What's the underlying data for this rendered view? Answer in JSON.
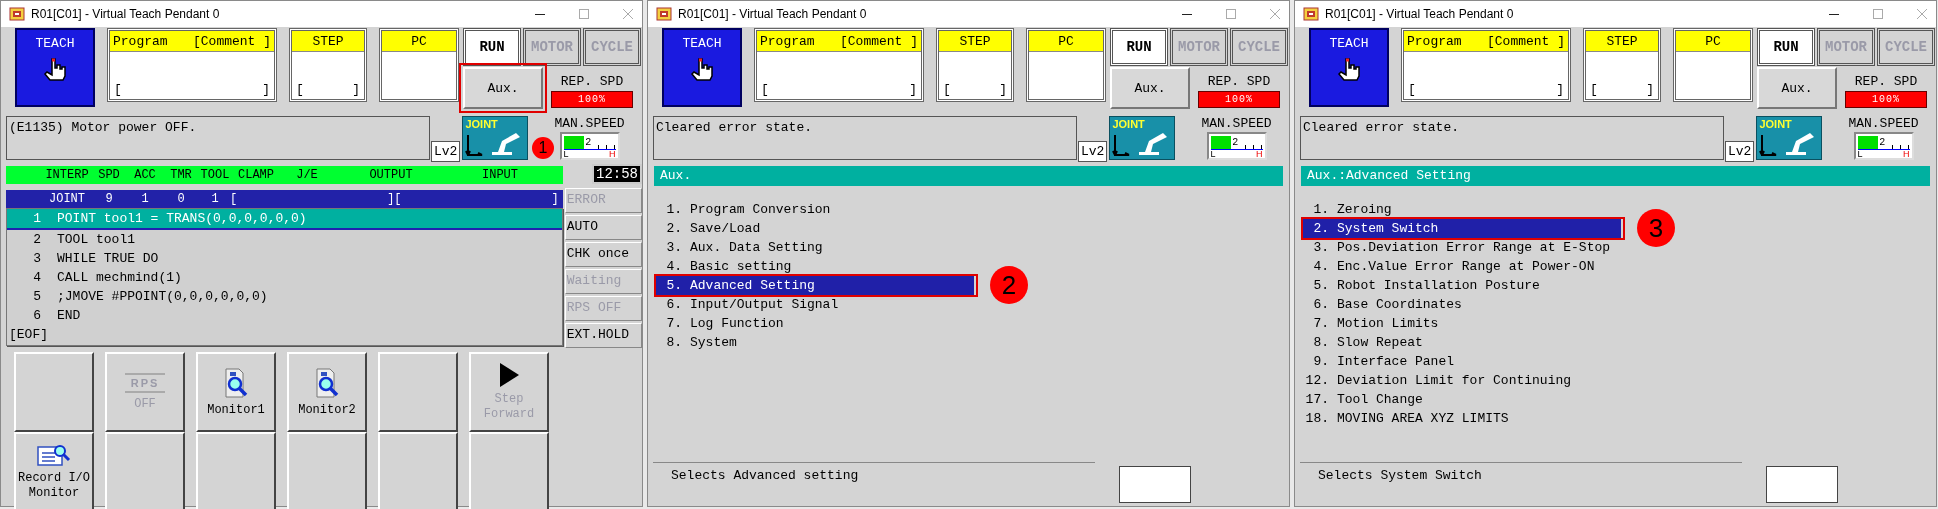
{
  "windows": [
    {
      "title": "R01[C01] - Virtual Teach Pendant 0",
      "header": {
        "teach": "TEACH",
        "program": {
          "label": "Program",
          "comment": "[Comment ]",
          "open": "[",
          "close": "]"
        },
        "step": {
          "label": "STEP",
          "open": "[",
          "close": "]"
        },
        "pc": {
          "label": "PC"
        },
        "modes": [
          {
            "label": "RUN",
            "disabled": false
          },
          {
            "label": "MOTOR",
            "disabled": true
          },
          {
            "label": "CYCLE",
            "disabled": true
          }
        ],
        "aux": {
          "label": "Aux.",
          "highlighted": true
        },
        "callout": "1",
        "rep_spd": {
          "label": "REP. SPD",
          "value": "100%"
        },
        "message": "(E1135) Motor power OFF.",
        "user_level": "Lv2",
        "joint": "JOINT",
        "man_speed": {
          "label": "MAN.SPEED",
          "value": "2",
          "low": "L",
          "high": "H",
          "level": 0.4
        }
      },
      "body": {
        "kind": "program",
        "columns": [
          "INTERP",
          "SPD",
          "ACC",
          "TMR",
          "TOOL",
          "CLAMP",
          "J/E",
          "OUTPUT",
          "INPUT"
        ],
        "clock": "12:58",
        "status_values": [
          "JOINT",
          "9",
          "1",
          "0",
          "1"
        ],
        "brackets": [
          "[",
          "][",
          "]"
        ],
        "lines": [
          {
            "number": "1",
            "code": "POINT tool1 = TRANS(0,0,0,0,0,0)",
            "selected": true
          },
          {
            "number": "2",
            "code": "TOOL tool1",
            "selected": false
          },
          {
            "number": "3",
            "code": "WHILE TRUE DO",
            "selected": false
          },
          {
            "number": "4",
            "code": "CALL mechmind(1)",
            "selected": false
          },
          {
            "number": "5",
            "code": ";JMOVE #PPOINT(0,0,0,0,0,0)",
            "selected": false
          },
          {
            "number": "6",
            "code": "END",
            "selected": false
          }
        ],
        "eof": "[EOF]",
        "statuses": [
          {
            "label": "ERROR",
            "disabled": true
          },
          {
            "label": "AUTO",
            "disabled": false
          },
          {
            "label": "CHK once",
            "disabled": false
          },
          {
            "label": "Waiting",
            "disabled": true
          },
          {
            "label": "RPS OFF",
            "disabled": true
          },
          {
            "label": "EXT.HOLD",
            "disabled": false
          }
        ],
        "keys": [
          {
            "kind": "empty"
          },
          {
            "kind": "rps",
            "icon_text": "RPS",
            "label": "OFF",
            "disabled": true
          },
          {
            "kind": "monitor",
            "label": "Monitor1",
            "disabled": false
          },
          {
            "kind": "monitor",
            "label": "Monitor2",
            "disabled": false
          },
          {
            "kind": "empty"
          },
          {
            "kind": "play",
            "label": "Step Forward",
            "disabled": true
          },
          {
            "kind": "record",
            "label": "Record I/O Monitor",
            "disabled": false
          },
          {
            "kind": "empty"
          },
          {
            "kind": "empty"
          },
          {
            "kind": "empty"
          },
          {
            "kind": "empty"
          },
          {
            "kind": "empty"
          }
        ]
      }
    },
    {
      "title": "R01[C01] - Virtual Teach Pendant 0",
      "header": {
        "teach": "TEACH",
        "program": {
          "label": "Program",
          "comment": "[Comment ]",
          "open": "[",
          "close": "]"
        },
        "step": {
          "label": "STEP",
          "open": "[",
          "close": "]"
        },
        "pc": {
          "label": "PC"
        },
        "modes": [
          {
            "label": "RUN",
            "disabled": false
          },
          {
            "label": "MOTOR",
            "disabled": true
          },
          {
            "label": "CYCLE",
            "disabled": true
          }
        ],
        "aux": {
          "label": "Aux.",
          "highlighted": false
        },
        "rep_spd": {
          "label": "REP. SPD",
          "value": "100%"
        },
        "message": "Cleared error state.",
        "user_level": "Lv2",
        "joint": "JOINT",
        "man_speed": {
          "label": "MAN.SPEED",
          "value": "2",
          "low": "L",
          "high": "H",
          "level": 0.4
        }
      },
      "body": {
        "kind": "menu",
        "title": "Aux.",
        "callout": "2",
        "items": [
          {
            "number": "1.",
            "label": "Program Conversion",
            "selected": false
          },
          {
            "number": "2.",
            "label": "Save/Load",
            "selected": false
          },
          {
            "number": "3.",
            "label": "Aux. Data Setting",
            "selected": false
          },
          {
            "number": "4.",
            "label": "Basic setting",
            "selected": false
          },
          {
            "number": "5.",
            "label": "Advanced Setting",
            "selected": true
          },
          {
            "number": "6.",
            "label": "Input/Output Signal",
            "selected": false
          },
          {
            "number": "7.",
            "label": "Log Function",
            "selected": false
          },
          {
            "number": "8.",
            "label": "System",
            "selected": false
          }
        ],
        "hint": "Selects Advanced setting"
      }
    },
    {
      "title": "R01[C01] - Virtual Teach Pendant 0",
      "header": {
        "teach": "TEACH",
        "program": {
          "label": "Program",
          "comment": "[Comment ]",
          "open": "[",
          "close": "]"
        },
        "step": {
          "label": "STEP",
          "open": "[",
          "close": "]"
        },
        "pc": {
          "label": "PC"
        },
        "modes": [
          {
            "label": "RUN",
            "disabled": false
          },
          {
            "label": "MOTOR",
            "disabled": true
          },
          {
            "label": "CYCLE",
            "disabled": true
          }
        ],
        "aux": {
          "label": "Aux.",
          "highlighted": false
        },
        "rep_spd": {
          "label": "REP. SPD",
          "value": "100%"
        },
        "message": "Cleared error state.",
        "user_level": "Lv2",
        "joint": "JOINT",
        "man_speed": {
          "label": "MAN.SPEED",
          "value": "2",
          "low": "L",
          "high": "H",
          "level": 0.4
        }
      },
      "body": {
        "kind": "menu",
        "title": "Aux.:Advanced Setting",
        "callout": "3",
        "items": [
          {
            "number": "1.",
            "label": "Zeroing",
            "selected": false
          },
          {
            "number": "2.",
            "label": "System Switch",
            "selected": true
          },
          {
            "number": "3.",
            "label": "Pos.Deviation Error Range at E-Stop",
            "selected": false
          },
          {
            "number": "4.",
            "label": "Enc.Value Error Range at Power-ON",
            "selected": false
          },
          {
            "number": "5.",
            "label": "Robot Installation Posture",
            "selected": false
          },
          {
            "number": "6.",
            "label": "Base Coordinates",
            "selected": false
          },
          {
            "number": "7.",
            "label": "Motion Limits",
            "selected": false
          },
          {
            "number": "8.",
            "label": "Slow Repeat",
            "selected": false
          },
          {
            "number": "9.",
            "label": "Interface Panel",
            "selected": false
          },
          {
            "number": "12.",
            "label": "Deviation Limit for Continuing",
            "selected": false
          },
          {
            "number": "17.",
            "label": "Tool Change",
            "selected": false
          },
          {
            "number": "18.",
            "label": "MOVING AREA XYZ LIMITS",
            "selected": false
          }
        ],
        "hint": "Selects System Switch"
      }
    }
  ]
}
